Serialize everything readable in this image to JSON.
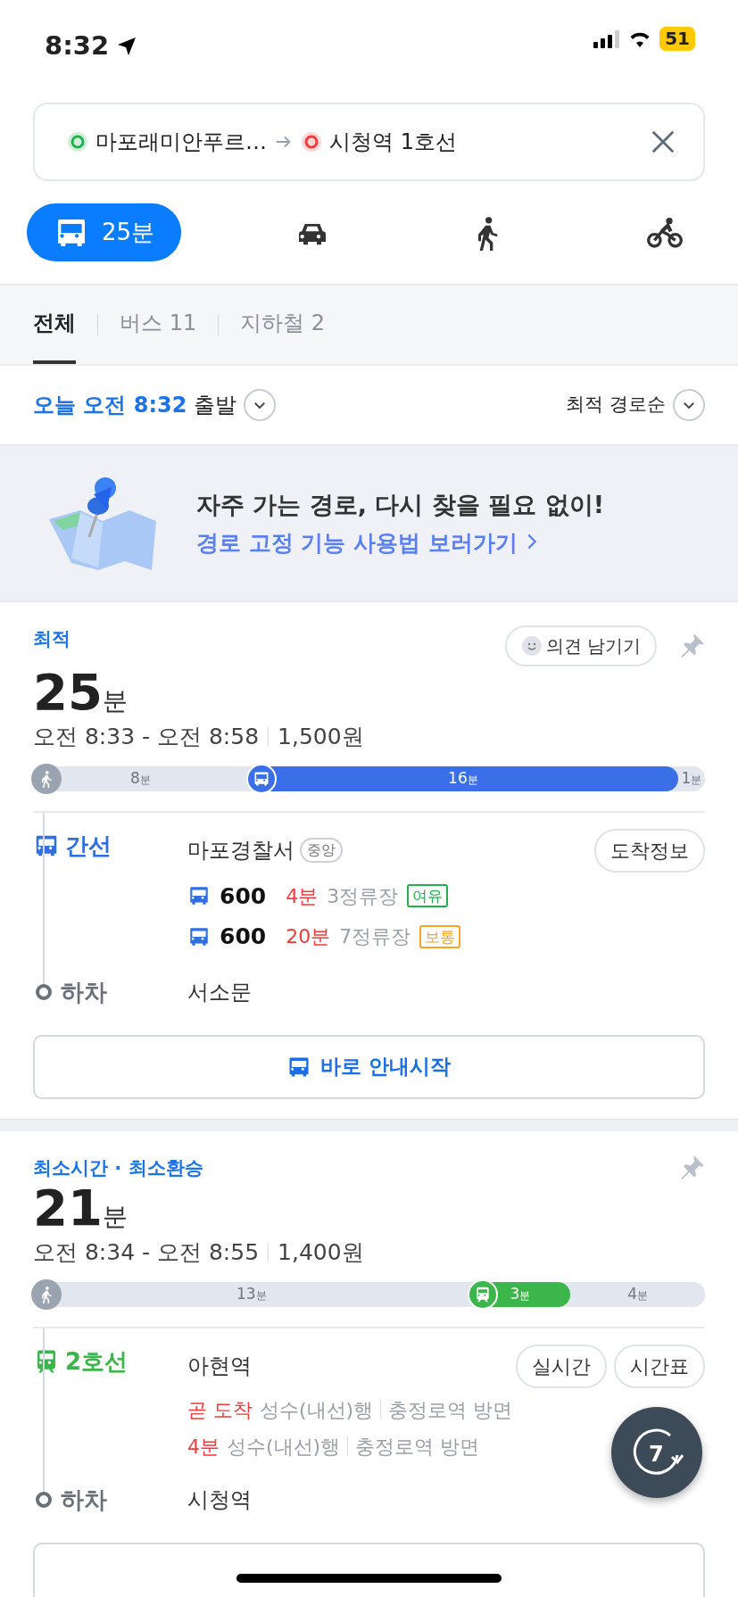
{
  "status_bar": {
    "time": "8:32",
    "battery": "51"
  },
  "search": {
    "origin": "마포래미안푸르…",
    "destination": "시청역 1호선"
  },
  "modes": [
    {
      "kind": "transit",
      "label": "25분",
      "selected": true
    },
    {
      "kind": "car",
      "selected": false
    },
    {
      "kind": "walk",
      "selected": false
    },
    {
      "kind": "bike",
      "selected": false
    }
  ],
  "filters": [
    {
      "label": "전체",
      "selected": true
    },
    {
      "label": "버스 11",
      "selected": false
    },
    {
      "label": "지하철 2",
      "selected": false
    }
  ],
  "departure": {
    "time": "오늘 오전 8:32",
    "suffix": "출발"
  },
  "sort": "최적 경로순",
  "banner": {
    "title": "자주 가는 경로, 다시 찾을 필요 없이!",
    "link": "경로 고정 기능 사용법 보러가기"
  },
  "routes": [
    {
      "tag": "최적",
      "feedback": "의견 남기기",
      "duration": "25",
      "unit": "분",
      "times": "오전 8:33 - 오전 8:58",
      "fare": "1,500원",
      "segments": [
        {
          "kind": "walk",
          "minutes": "8",
          "unit": "분"
        },
        {
          "kind": "bus",
          "minutes": "16",
          "unit": "분"
        },
        {
          "kind": "walk",
          "minutes": "1",
          "unit": "분"
        }
      ],
      "board": {
        "kind": "bus",
        "line": "간선",
        "stop": "마포경찰서",
        "stop_tag": "중앙",
        "buttons": [
          "도착정보"
        ],
        "arrivals": [
          {
            "kind": "bus",
            "route": "600",
            "eta": "4분",
            "info": "3정류장",
            "crowd": "여유",
            "color": "#22b14c"
          },
          {
            "kind": "bus",
            "route": "600",
            "eta": "20분",
            "info": "7정류장",
            "crowd": "보통",
            "color": "#f5a623"
          }
        ]
      },
      "alight": {
        "label": "하차",
        "stop": "서소문"
      },
      "start_button": "바로 안내시작"
    },
    {
      "tag": "최소시간 · 최소환승",
      "duration": "21",
      "unit": "분",
      "times": "오전 8:34 - 오전 8:55",
      "fare": "1,400원",
      "segments": [
        {
          "kind": "walk",
          "minutes": "13",
          "unit": "분"
        },
        {
          "kind": "subway",
          "minutes": "3",
          "unit": "분"
        },
        {
          "kind": "walk",
          "minutes": "4",
          "unit": "분"
        }
      ],
      "board": {
        "kind": "subway",
        "line": "2호선",
        "stop": "아현역",
        "buttons": [
          "실시간",
          "시간표"
        ],
        "arrivals": [
          {
            "kind": "train",
            "eta": "곧 도착",
            "direction": "성수(내선)행",
            "via": "충정로역 방면"
          },
          {
            "kind": "train",
            "eta": "4분",
            "direction": "성수(내선)행",
            "via": "충정로역 방면"
          }
        ]
      },
      "alight": {
        "label": "하차",
        "stop": "시청역"
      }
    }
  ],
  "floating_button": {
    "label": "7"
  }
}
